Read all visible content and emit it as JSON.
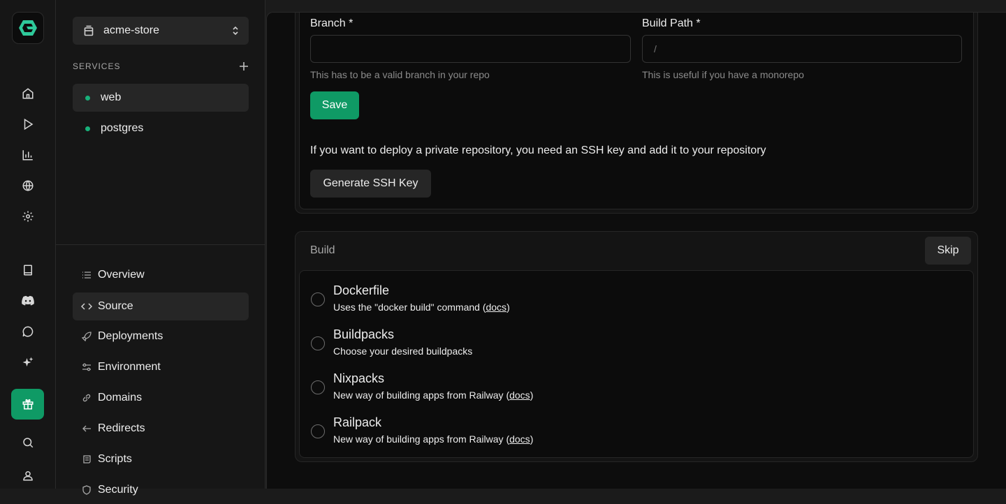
{
  "rail": {
    "icons": [
      "home-icon",
      "play-icon",
      "chart-icon",
      "globe-icon",
      "gear-icon",
      "book-icon",
      "discord-icon",
      "chat-icon",
      "sparkles-icon",
      "gift-icon",
      "search-icon",
      "user-icon"
    ]
  },
  "project": {
    "name": "acme-store"
  },
  "services": {
    "heading": "SERVICES",
    "items": [
      {
        "label": "web",
        "active": true
      },
      {
        "label": "postgres",
        "active": false
      }
    ]
  },
  "nav": {
    "items": [
      {
        "label": "Overview",
        "icon": "list-icon"
      },
      {
        "label": "Source",
        "icon": "code-icon"
      },
      {
        "label": "Deployments",
        "icon": "rocket-icon"
      },
      {
        "label": "Environment",
        "icon": "sliders-icon"
      },
      {
        "label": "Domains",
        "icon": "link-icon"
      },
      {
        "label": "Redirects",
        "icon": "arrow-left-icon"
      },
      {
        "label": "Scripts",
        "icon": "scroll-icon"
      },
      {
        "label": "Security",
        "icon": "shield-icon"
      }
    ]
  },
  "source": {
    "branch_label": "Branch *",
    "branch_value": "",
    "branch_hint": "This has to be a valid branch in your repo",
    "build_path_label": "Build Path *",
    "build_path_placeholder": "/",
    "build_path_hint": "This is useful if you have a monorepo",
    "save_label": "Save",
    "ssh_text": "If you want to deploy a private repository, you need an SSH key and add it to your repository",
    "ssh_button": "Generate SSH Key"
  },
  "build": {
    "title": "Build",
    "skip_label": "Skip",
    "options": [
      {
        "title": "Dockerfile",
        "desc_before": "Uses the \"docker build\" command (",
        "link": "docs",
        "desc_after": ")"
      },
      {
        "title": "Buildpacks",
        "desc_before": "Choose your desired buildpacks",
        "link": "",
        "desc_after": ""
      },
      {
        "title": "Nixpacks",
        "desc_before": "New way of building apps from Railway (",
        "link": "docs",
        "desc_after": ")"
      },
      {
        "title": "Railpack",
        "desc_before": "New way of building apps from Railway (",
        "link": "docs",
        "desc_after": ")"
      }
    ]
  },
  "colors": {
    "accent": "#0f9a65",
    "status_dot": "#18b07a",
    "background": "#0d0d0d"
  }
}
